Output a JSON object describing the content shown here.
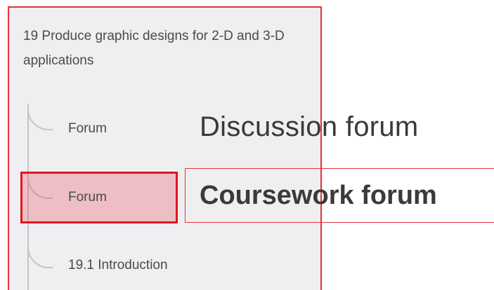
{
  "sidebar": {
    "section_title": "19 Produce graphic designs for 2-D and 3-D applications",
    "items": [
      {
        "label": "Forum"
      },
      {
        "label": "Forum"
      },
      {
        "label": "19.1 Introduction"
      }
    ]
  },
  "annotations": {
    "discussion_label": "Discussion forum",
    "coursework_label": "Coursework forum"
  },
  "colors": {
    "annotation_red": "#e8323a",
    "highlight_fill": "#f2b8bb",
    "panel_background": "#efeff1"
  }
}
